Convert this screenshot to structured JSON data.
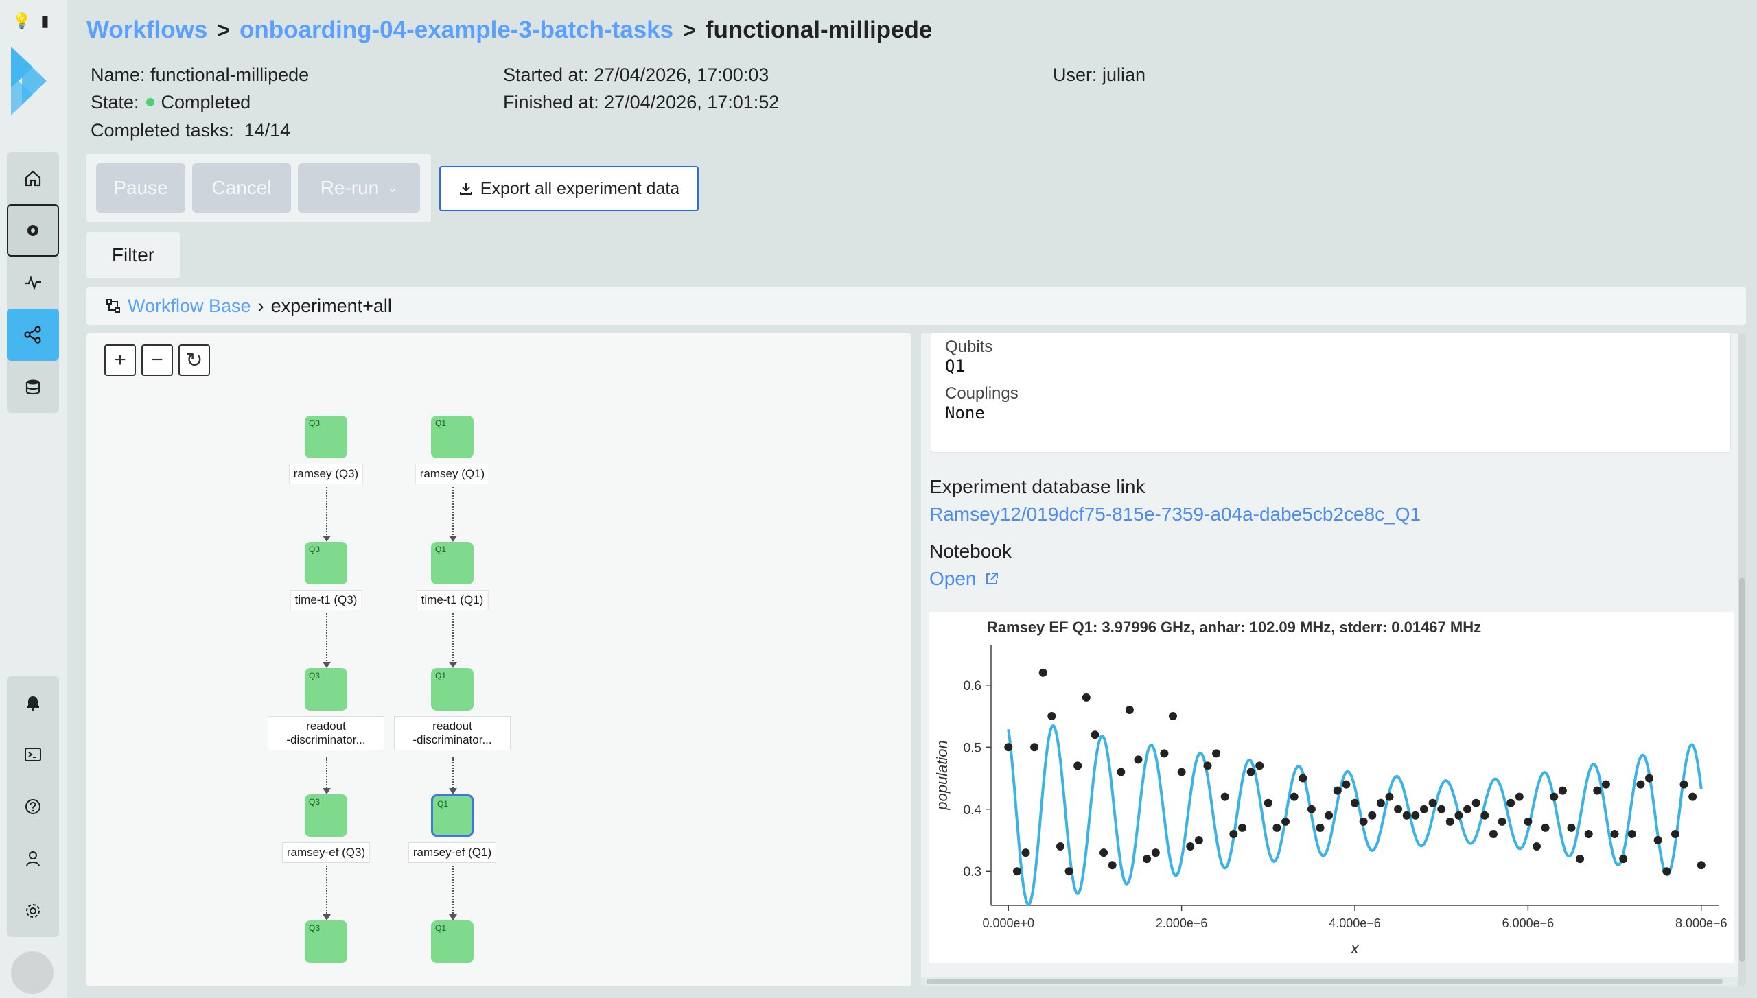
{
  "breadcrumb": {
    "workflows": "Workflows",
    "group": "onboarding-04-example-3-batch-tasks",
    "current": "functional-millipede",
    "sep": ">"
  },
  "info": {
    "name": "Name: functional-millipede",
    "state_label": "State:",
    "state_value": "Completed",
    "tasks_label": "Completed tasks:",
    "tasks_value": "14/14",
    "started": "Started at: 27/04/2026, 17:00:03",
    "finished": "Finished at: 27/04/2026, 17:01:52",
    "user": "User: julian"
  },
  "actions": {
    "pause": "Pause",
    "cancel": "Cancel",
    "rerun": "Re-run",
    "export": "Export all experiment data",
    "filter": "Filter"
  },
  "path": {
    "base": "Workflow Base",
    "current": "experiment+all"
  },
  "graph": {
    "zoom_in": "+",
    "zoom_out": "−",
    "reset": "↻",
    "columns": [
      {
        "qubit": "Q3",
        "nodes": [
          "ramsey (Q3)",
          "time-t1 (Q3)",
          "readout\n-discriminator...",
          "ramsey-ef (Q3)",
          ""
        ]
      },
      {
        "qubit": "Q1",
        "nodes": [
          "ramsey (Q1)",
          "time-t1 (Q1)",
          "readout\n-discriminator...",
          "ramsey-ef (Q1)",
          ""
        ]
      }
    ]
  },
  "detail": {
    "qubits_label": "Qubits",
    "qubits_value": "Q1",
    "couplings_label": "Couplings",
    "couplings_value": "None",
    "db_title": "Experiment database link",
    "db_link": "Ramsey12/019dcf75-815e-7359-a04a-dabe5cb2ce8c_Q1",
    "notebook_title": "Notebook",
    "notebook_link": "Open"
  },
  "colors": {
    "accent": "#5aa0ff",
    "active_nav": "#45b6f0",
    "node_green": "#7fda8e",
    "fit_line": "#3bb3e6"
  },
  "chart_data": {
    "type": "scatter",
    "title": "Ramsey EF Q1: 3.97996 GHz, anhar: 102.09 MHz, stderr: 0.01467 MHz",
    "xlabel": "x",
    "ylabel": "population",
    "xlim": [
      -2e-07,
      8.2e-06
    ],
    "ylim": [
      0.245,
      0.665
    ],
    "xticks": [
      0,
      2e-06,
      4e-06,
      6e-06,
      8e-06
    ],
    "xtick_labels": [
      "0.000e+0",
      "2.000e−6",
      "4.000e−6",
      "6.000e−6",
      "8.000e−6"
    ],
    "yticks": [
      0.3,
      0.4,
      0.5,
      0.6
    ],
    "ytick_labels": [
      "0.3",
      "0.4",
      "0.5",
      "0.6"
    ],
    "series": [
      {
        "type": "scatter",
        "x": [
          0,
          1e-07,
          2e-07,
          3e-07,
          4e-07,
          5e-07,
          6e-07,
          7e-07,
          8e-07,
          9e-07,
          1e-06,
          1.1e-06,
          1.2e-06,
          1.3e-06,
          1.4e-06,
          1.5e-06,
          1.6e-06,
          1.7e-06,
          1.8e-06,
          1.9e-06,
          2e-06,
          2.1e-06,
          2.2e-06,
          2.3e-06,
          2.4e-06,
          2.5e-06,
          2.6e-06,
          2.7e-06,
          2.8e-06,
          2.9e-06,
          3e-06,
          3.1e-06,
          3.2e-06,
          3.3e-06,
          3.4e-06,
          3.5e-06,
          3.6e-06,
          3.7e-06,
          3.8e-06,
          3.9e-06,
          4e-06,
          4.1e-06,
          4.2e-06,
          4.3e-06,
          4.4e-06,
          4.5e-06,
          4.6e-06,
          4.7e-06,
          4.8e-06,
          4.9e-06,
          5e-06,
          5.1e-06,
          5.2e-06,
          5.3e-06,
          5.4e-06,
          5.5e-06,
          5.6e-06,
          5.7e-06,
          5.8e-06,
          5.9e-06,
          6e-06,
          6.1e-06,
          6.2e-06,
          6.3e-06,
          6.4e-06,
          6.5e-06,
          6.6e-06,
          6.7e-06,
          6.8e-06,
          6.9e-06,
          7e-06,
          7.1e-06,
          7.2e-06,
          7.3e-06,
          7.4e-06,
          7.5e-06,
          7.6e-06,
          7.7e-06,
          7.8e-06,
          7.9e-06,
          8e-06
        ],
        "y": [
          0.5,
          0.3,
          0.33,
          0.5,
          0.62,
          0.55,
          0.34,
          0.3,
          0.47,
          0.58,
          0.52,
          0.33,
          0.31,
          0.46,
          0.56,
          0.48,
          0.32,
          0.33,
          0.49,
          0.55,
          0.46,
          0.34,
          0.35,
          0.47,
          0.49,
          0.42,
          0.36,
          0.37,
          0.46,
          0.47,
          0.41,
          0.37,
          0.38,
          0.42,
          0.45,
          0.4,
          0.37,
          0.39,
          0.43,
          0.44,
          0.41,
          0.38,
          0.39,
          0.41,
          0.42,
          0.4,
          0.39,
          0.39,
          0.4,
          0.41,
          0.4,
          0.38,
          0.39,
          0.4,
          0.41,
          0.39,
          0.36,
          0.38,
          0.41,
          0.42,
          0.38,
          0.34,
          0.37,
          0.42,
          0.43,
          0.37,
          0.32,
          0.36,
          0.43,
          0.44,
          0.36,
          0.32,
          0.36,
          0.44,
          0.45,
          0.35,
          0.3,
          0.36,
          0.44,
          0.42,
          0.31
        ]
      },
      {
        "type": "line",
        "name": "",
        "model": {
          "offset": 0.395,
          "amplitude": 0.165,
          "decay": 4.5e-06,
          "frequency": 1.85e-06,
          "phase": 0.0,
          "beat_frequency": 110000.0
        }
      }
    ]
  }
}
